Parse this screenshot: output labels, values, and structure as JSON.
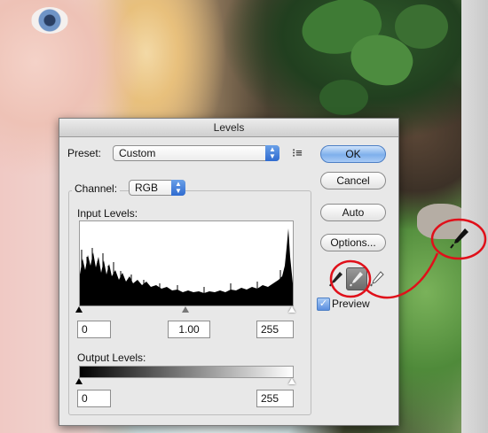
{
  "dialog": {
    "title": "Levels",
    "preset_label": "Preset:",
    "preset_value": "Custom",
    "channel_label": "Channel:",
    "channel_value": "RGB",
    "input_levels_label": "Input Levels:",
    "input_black": "0",
    "input_gamma": "1.00",
    "input_white": "255",
    "output_levels_label": "Output Levels:",
    "output_black": "0",
    "output_white": "255",
    "preview_label": "Preview",
    "preview_checked": true
  },
  "buttons": {
    "ok": "OK",
    "cancel": "Cancel",
    "auto": "Auto",
    "options": "Options..."
  },
  "icons": {
    "preset_menu": "preset-options-icon",
    "black_eyedropper": "black-point-eyedropper-icon",
    "gray_eyedropper": "gray-point-eyedropper-icon",
    "white_eyedropper": "white-point-eyedropper-icon"
  },
  "colors": {
    "default_button": "#7fb0ec",
    "annotation": "#e0101a"
  }
}
